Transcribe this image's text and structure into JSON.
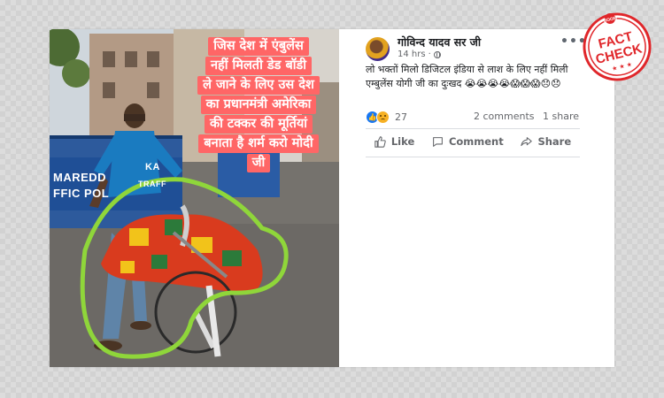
{
  "image_overlay": {
    "lines": [
      "जिस देश में एंबुलेंस",
      "नहीं मिलती डेड बॉडी",
      "ले जाने के लिए उस देश",
      "का प्रधानमंत्री अमेरिका",
      "की टक्कर की मूर्तियां",
      "बनाता है शर्म करो मोदी",
      "जी"
    ],
    "barricade_text_1": "MAREDD",
    "barricade_text_2": "FFIC POL",
    "barricade_text_3": "KA",
    "barricade_text_4": "TRAFF"
  },
  "post": {
    "author": "गोविन्द यादव सर जी",
    "time": "14 hrs",
    "text": "लो भक्तों मिलो डिजिटल इंडिया से लाश के लिए नहीं मिली एम्बुलेंस योगी जी का दुःखद 😭😭😭😭😱😱😱😞😞",
    "more_icon": "more-options-icon",
    "reactions": {
      "count": "27",
      "types": [
        "like",
        "sad"
      ]
    },
    "comments": "2 comments",
    "shares": "1 share",
    "actions": {
      "like": "Like",
      "comment": "Comment",
      "share": "Share"
    }
  },
  "stamp": {
    "top": "BOOM",
    "line1": "FACT",
    "line2": "CHECK",
    "color": "#e0262a"
  }
}
